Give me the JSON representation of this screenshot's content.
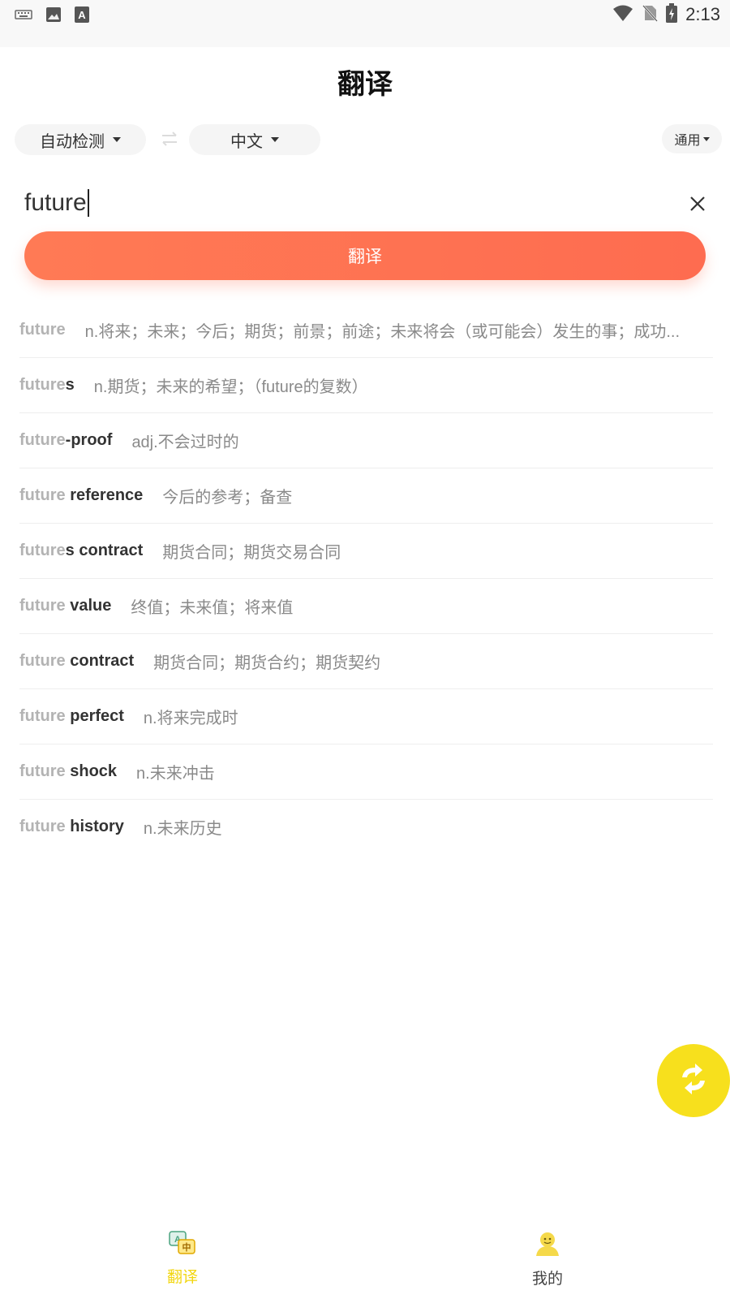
{
  "status_bar": {
    "time": "2:13",
    "icons": [
      "keyboard-icon",
      "image-icon",
      "text-a-icon",
      "wifi-icon",
      "no-sim-icon",
      "battery-charging-icon"
    ]
  },
  "header": {
    "title": "翻译"
  },
  "language_bar": {
    "source": "自动检测",
    "target": "中文",
    "mode": "通用",
    "swap_icon": "swap-arrows-icon"
  },
  "input": {
    "value": "future",
    "clear_icon": "close-icon"
  },
  "translate_button": {
    "label": "翻译",
    "color_start": "#ff7a55",
    "color_end": "#fe6c50"
  },
  "suggestions": [
    {
      "match": "future",
      "rest": "",
      "definition": "n.将来；未来；今后；期货；前景；前途；未来将会（或可能会）发生的事；成功..."
    },
    {
      "match": "future",
      "rest": "s",
      "definition": "n.期货；未来的希望；（future的复数）"
    },
    {
      "match": "future",
      "rest": "-proof",
      "definition": "adj.不会过时的"
    },
    {
      "match": "future",
      "rest": " reference",
      "definition": "今后的参考；备查"
    },
    {
      "match": "future",
      "rest": "s contract",
      "definition": "期货合同；期货交易合同"
    },
    {
      "match": "future",
      "rest": " value",
      "definition": "终值；未来值；将来值"
    },
    {
      "match": "future",
      "rest": " contract",
      "definition": "期货合同；期货合约；期货契约"
    },
    {
      "match": "future",
      "rest": " perfect",
      "definition": "n.将来完成时"
    },
    {
      "match": "future",
      "rest": " shock",
      "definition": "n.未来冲击"
    },
    {
      "match": "future",
      "rest": " history",
      "definition": "n.未来历史"
    }
  ],
  "fab": {
    "icon": "refresh-icon",
    "color": "#f7e01d"
  },
  "bottom_nav": {
    "items": [
      {
        "label": "翻译",
        "icon": "translate-icon",
        "active": true
      },
      {
        "label": "我的",
        "icon": "profile-icon",
        "active": false
      }
    ],
    "active_color": "#f2d60f"
  }
}
